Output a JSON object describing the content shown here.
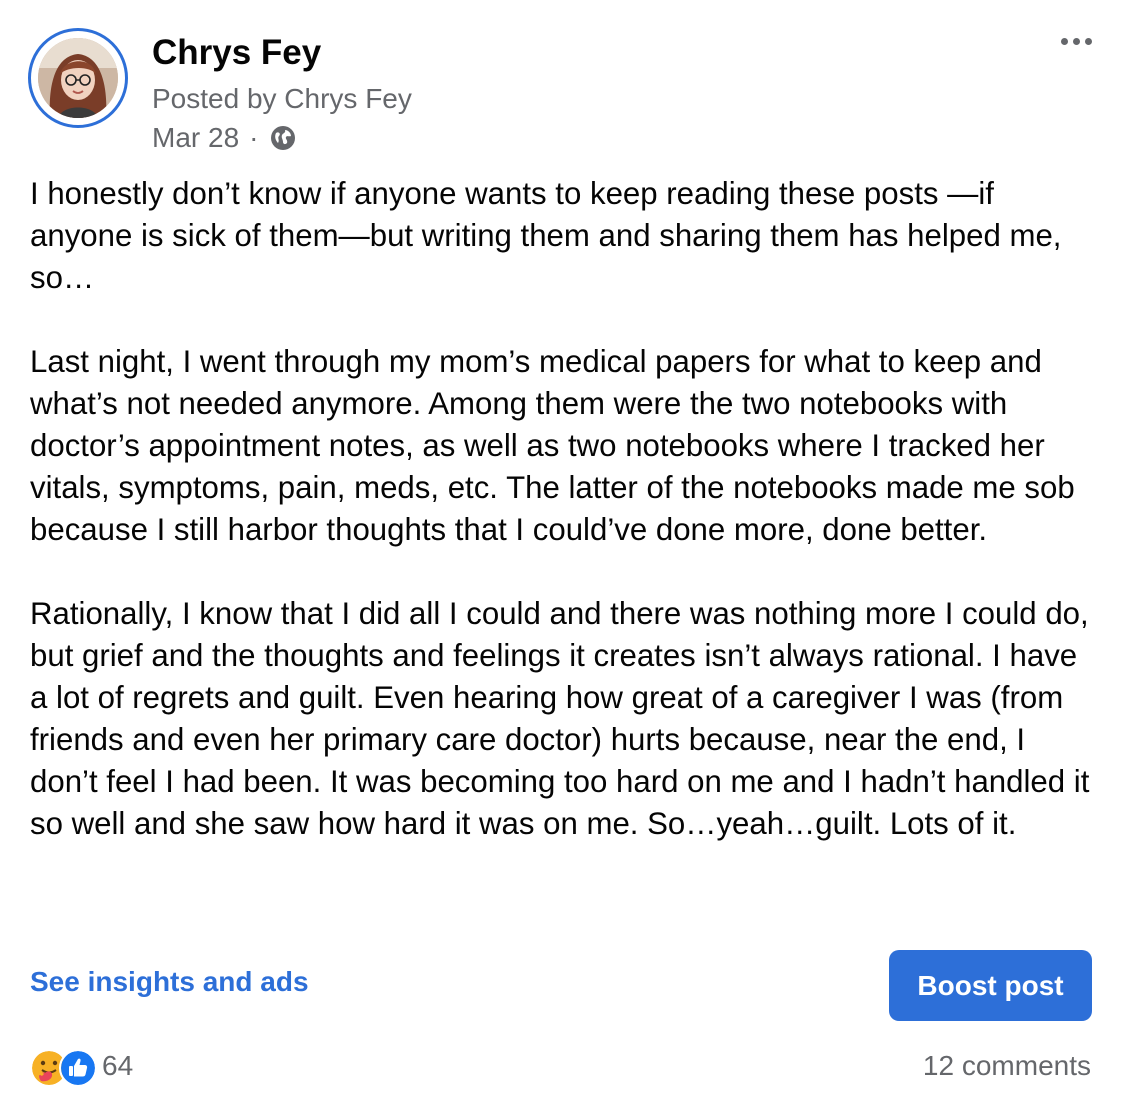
{
  "post": {
    "author_name": "Chrys Fey",
    "posted_by": "Posted by Chrys Fey",
    "date": "Mar 28",
    "separator": "·",
    "audience_icon": "globe-icon",
    "more_icon": "more-options-icon",
    "paragraphs": [
      "I honestly don’t know if anyone wants to keep reading these posts —if anyone is sick of them—but writing them and sharing them has helped me, so…",
      "Last night, I went through my mom’s medical papers for what to keep and what’s not needed anymore. Among them were the two notebooks with doctor’s appointment notes, as well as two notebooks where I tracked her vitals, symptoms, pain, meds, etc. The latter of the notebooks made me sob because I still harbor thoughts that I could’ve done more, done better.",
      "Rationally, I know that I did all I could and there was nothing more I could do, but grief and the thoughts and feelings it creates isn’t always rational. I have a lot of regrets and guilt. Even hearing how great of a caregiver I was (from friends and even her primary care doctor) hurts because, near the end, I don’t feel I had been. It was becoming too hard on me and I hadn’t handled it so well and she saw how hard it was on me. So…yeah…guilt. Lots of it."
    ]
  },
  "actions": {
    "insights_label": "See insights and ads",
    "boost_label": "Boost post"
  },
  "footer": {
    "reaction_icons": [
      "care-reaction-icon",
      "like-reaction-icon"
    ],
    "reaction_count": "64",
    "comments_label": "12 comments"
  },
  "colors": {
    "accent": "#2d6fd8",
    "secondary_text": "#65676b",
    "primary_text": "#050505"
  }
}
